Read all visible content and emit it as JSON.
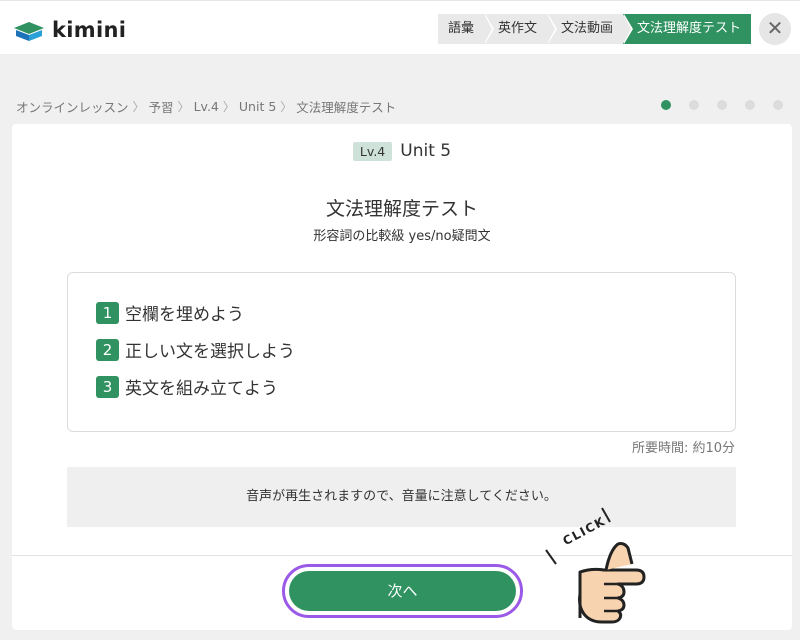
{
  "header": {
    "logo_text": "kimini",
    "tabs": [
      {
        "label": "語彙"
      },
      {
        "label": "英作文"
      },
      {
        "label": "文法動画"
      },
      {
        "label": "文法理解度テスト"
      }
    ],
    "close_symbol": "✕"
  },
  "breadcrumb": [
    "オンラインレッスン",
    "予習",
    "Lv.4",
    "Unit 5",
    "文法理解度テスト"
  ],
  "progress": {
    "current": 1,
    "total": 5
  },
  "card": {
    "level_badge": "Lv.4",
    "unit": "Unit 5",
    "title": "文法理解度テスト",
    "subtitle": "形容詞の比較級 yes/no疑問文",
    "steps": [
      {
        "num": "1",
        "text": "空欄を埋めよう"
      },
      {
        "num": "2",
        "text": "正しい文を選択しよう"
      },
      {
        "num": "3",
        "text": "英文を組み立てよう"
      }
    ],
    "time_note": "所要時間: 約10分",
    "notice": "音声が再生されますので、音量に注意してください。",
    "next_button": "次へ",
    "click_hint": "CLICK"
  },
  "colors": {
    "accent": "#2f9260",
    "highlight": "#9b59e8"
  }
}
